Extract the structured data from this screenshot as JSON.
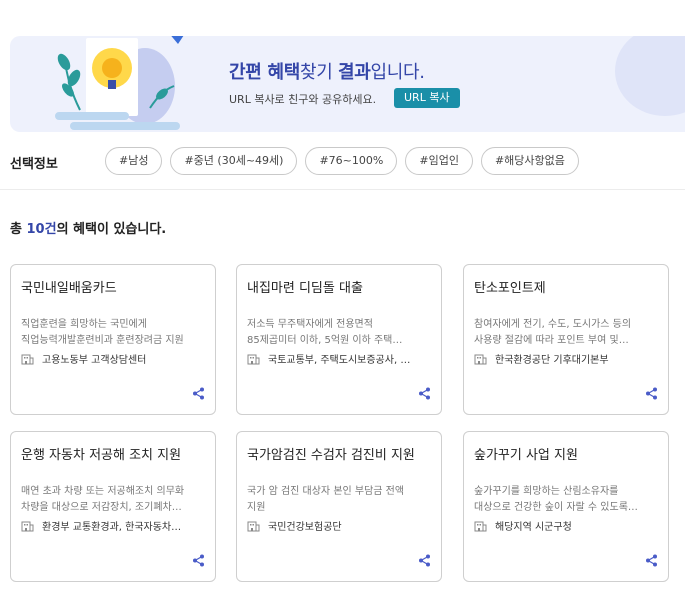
{
  "banner": {
    "title_hl1": "간편 혜택",
    "title_mid": "찾기 ",
    "title_hl2": "결과",
    "title_end": "입니다.",
    "subtitle": "URL 복사로 친구와 공유하세요.",
    "url_button": "URL 복사"
  },
  "selection": {
    "label": "선택정보",
    "tags": [
      "#남성",
      "#중년 (30세~49세)",
      "#76~100%",
      "#임업인",
      "#해당사항없음"
    ]
  },
  "result": {
    "prefix": "총 ",
    "count": "10건",
    "suffix": "의 혜택이 있습니다."
  },
  "cards": [
    {
      "title": "국민내일배움카드",
      "desc1": "직업훈련을 희망하는 국민에게",
      "desc2": "직업능력개발훈련비과 훈련장려금 지원",
      "org": "고용노동부 고객상담센터"
    },
    {
      "title": "내집마련 디딤돌 대출",
      "desc1": "저소득 무주택자에게 전용면적",
      "desc2": "85제곱미터 이하, 5억원 이하 주택…",
      "org": "국토교통부, 주택도시보증공사, …"
    },
    {
      "title": "탄소포인트제",
      "desc1": "참여자에게 전기, 수도, 도시가스 등의",
      "desc2": "사용량 절감에 따라 포인트 부여 및…",
      "org": "한국환경공단 기후대기본부"
    },
    {
      "title": "운행 자동차 저공해 조치 지원",
      "desc1": "매연 초과 차량 또는 저공해조치 의무화",
      "desc2": "차량을 대상으로 저감장치, 조기폐차…",
      "org": "환경부 교통환경과, 한국자동차…"
    },
    {
      "title": "국가암검진 수검자 검진비 지원",
      "desc1": "국가 암 검진 대상자 본인 부담금 전액",
      "desc2": "지원",
      "org": "국민건강보험공단"
    },
    {
      "title": "숲가꾸기 사업 지원",
      "desc1": "숲가꾸기를 희망하는 산림소유자를",
      "desc2": "대상으로 건강한 숲이 자랄 수 있도록…",
      "org": "해당지역 시군구청"
    }
  ],
  "colors": {
    "accent": "#3446a8",
    "button": "#1a8fa8",
    "banner_bg": "#eef1fc"
  },
  "icons": {
    "org": "building-icon",
    "share": "share-icon"
  }
}
